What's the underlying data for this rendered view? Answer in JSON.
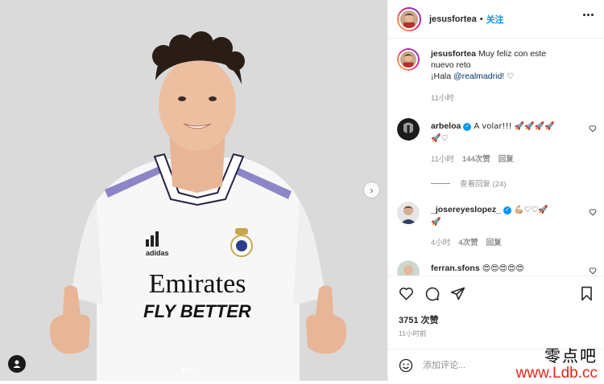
{
  "post": {
    "username": "jesusfortea",
    "separator": "•",
    "follow_label": "关注"
  },
  "caption": {
    "username": "jesusfortea",
    "text_line1": "Muy feliz con este",
    "text_line2": "nuevo reto",
    "text_prefix": "¡Hala ",
    "mention": "@realmadrid!",
    "heart": "♡",
    "time": "11小时"
  },
  "comments": [
    {
      "username": "arbeloa",
      "verified": true,
      "text": "A volar!!! 🚀🚀🚀🚀",
      "text2": "🚀♡",
      "time": "11小时",
      "likes": "144次赞",
      "reply": "回复"
    },
    {
      "username": "_josereyeslopez_",
      "verified": true,
      "text": "💪🏼♡♡🚀",
      "text2": "🚀",
      "time": "4小时",
      "likes": "4次赞",
      "reply": "回复"
    },
    {
      "username": "ferran.sfons",
      "verified": false,
      "text": "😍😍😍😍😍"
    }
  ],
  "view_replies": "查看回复 (24)",
  "likes_count": "3751 次赞",
  "post_time": "11小时前",
  "add_comment_placeholder": "添加评论...",
  "photo": {
    "sponsor_line1": "Emirates",
    "sponsor_line2": "FLY BETTER",
    "brand": "adidas"
  },
  "watermark": {
    "cn": "零点吧",
    "url": "www.Ldb.cc"
  },
  "icons": [
    "heart-icon",
    "comment-icon",
    "share-icon",
    "bookmark-icon",
    "more-icon",
    "tag-user-icon",
    "chevron-right-icon",
    "emoji-icon"
  ],
  "colors": {
    "accent": "#0095f6",
    "mention": "#00376b",
    "muted": "#8e8e8e",
    "watermark_red": "#e0261a"
  }
}
